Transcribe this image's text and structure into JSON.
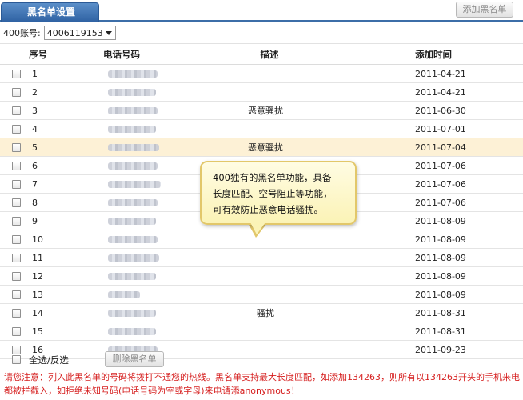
{
  "tabs": [
    {
      "label": "黑名单设置"
    }
  ],
  "toolbar": {
    "add_label": "添加黑名单"
  },
  "account": {
    "label": "400账号:",
    "value": "4006119153"
  },
  "table": {
    "headers": {
      "seq": "序号",
      "phone": "电话号码",
      "desc": "描述",
      "date": "添加时间"
    },
    "rows": [
      {
        "seq": "1",
        "desc": "",
        "date": "2011-04-21"
      },
      {
        "seq": "2",
        "desc": "",
        "date": "2011-04-21"
      },
      {
        "seq": "3",
        "desc": "恶意骚扰",
        "date": "2011-06-30"
      },
      {
        "seq": "4",
        "desc": "",
        "date": "2011-07-01"
      },
      {
        "seq": "5",
        "desc": "恶意骚扰",
        "date": "2011-07-04"
      },
      {
        "seq": "6",
        "desc": "",
        "date": "2011-07-06"
      },
      {
        "seq": "7",
        "desc": "",
        "date": "2011-07-06"
      },
      {
        "seq": "8",
        "desc": "",
        "date": "2011-07-06"
      },
      {
        "seq": "9",
        "desc": "",
        "date": "2011-08-09"
      },
      {
        "seq": "10",
        "desc": "",
        "date": "2011-08-09"
      },
      {
        "seq": "11",
        "desc": "",
        "date": "2011-08-09"
      },
      {
        "seq": "12",
        "desc": "",
        "date": "2011-08-09"
      },
      {
        "seq": "13",
        "desc": "",
        "date": "2011-08-09"
      },
      {
        "seq": "14",
        "desc": "骚扰",
        "date": "2011-08-31"
      },
      {
        "seq": "15",
        "desc": "",
        "date": "2011-08-31"
      },
      {
        "seq": "16",
        "desc": "",
        "date": "2011-09-23"
      }
    ]
  },
  "footer": {
    "select_all_label": "全选/反选",
    "delete_label": "删除黑名单"
  },
  "notice": {
    "text": "请您注意：列入此黑名单的号码将拨打不通您的热线。黑名单支持最大长度匹配，如添加134263，则所有以134263开头的手机来电都被拦截入，如拒绝未知号码(电话号码为空或字母)来电请添anonymous！"
  },
  "tooltip": {
    "line1": "400独有的黑名单功能，具备",
    "line2": "长度匹配、空号阻止等功能，",
    "line3": "可有效防止恶意电话骚扰。"
  },
  "colors": {
    "tab": "#3c6ea8",
    "highlight_row": "#fdf1d6",
    "notice": "#d62020",
    "tooltip": "#fbf3b6"
  }
}
